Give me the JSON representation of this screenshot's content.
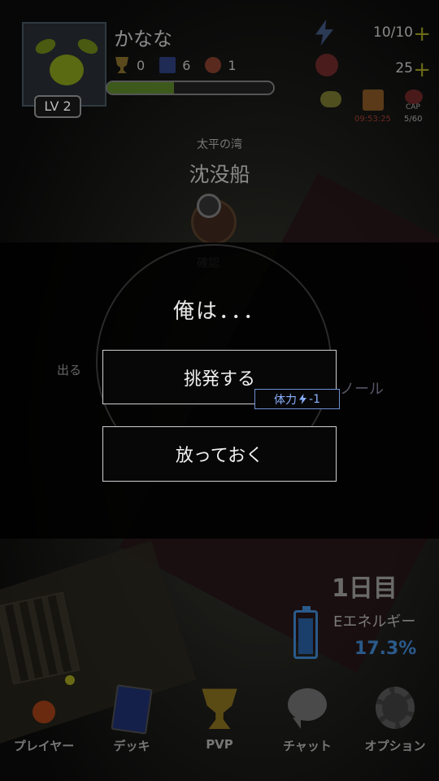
{
  "profile": {
    "name": "かなな",
    "level": "LV 2",
    "trophies": "0",
    "cards": "6",
    "gems": "1",
    "xp_progress": 0.4
  },
  "resources": {
    "energy": "10/10",
    "coins": "25",
    "gift_timer": "09:53:25",
    "cap_label": "CAP",
    "cap_value": "5/60",
    "plus": "+"
  },
  "location": {
    "subtitle": "太平の湾",
    "title": "沈没船",
    "confirm_label": "確認"
  },
  "background": {
    "exit_label": "出る",
    "npc_label": "ノール"
  },
  "dialog": {
    "text": "俺は．．．",
    "choices": [
      {
        "label": "挑発する",
        "cost_label": "体力",
        "cost_value": "-1"
      },
      {
        "label": "放っておく"
      }
    ]
  },
  "status": {
    "day": "1日目",
    "energy_label": "Eエネルギー",
    "energy_percent": "17.3%",
    "energy_level": 0.173
  },
  "nav": {
    "items": [
      {
        "label": "プレイヤー",
        "icon": "player-icon"
      },
      {
        "label": "デッキ",
        "icon": "deck-icon"
      },
      {
        "label": "PVP",
        "icon": "trophy-icon"
      },
      {
        "label": "チャット",
        "icon": "chat-icon"
      },
      {
        "label": "オプション",
        "icon": "gear-icon"
      }
    ]
  },
  "colors": {
    "accent_blue": "#8ab0ff",
    "plus_yellow": "#6b6a18",
    "dialog_border": "#cfcfcf"
  }
}
